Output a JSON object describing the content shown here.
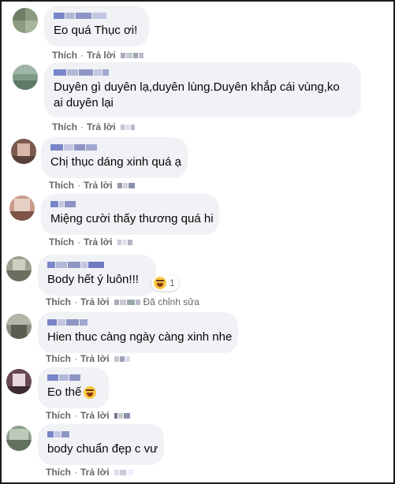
{
  "actions": {
    "like": "Thích",
    "reply": "Trả lời",
    "separator": "·"
  },
  "comments": [
    {
      "text": "Eo quá Thục ơi!"
    },
    {
      "text": "Duyên gì duyên lạ,duyên lùng.Duyên khắp cái vùng,ko ai duyên lại"
    },
    {
      "text": "Chị thục dáng xinh quá ạ"
    },
    {
      "text": "Miệng cười thấy thương quá hi"
    },
    {
      "text": "Body hết ý luôn!!!",
      "reaction": {
        "icon": "laughing-emoji",
        "count": "1"
      }
    },
    {
      "text": "Hien thuc càng ngày càng xinh nhe"
    },
    {
      "text": "Eo thế",
      "inline_emoji": "laughing-emoji"
    },
    {
      "text": "body chuẩn đẹp c vư"
    }
  ],
  "edited_label": "Đã chỉnh sửa",
  "colors": {
    "bubble": "#f0f2f5",
    "text": "#050505",
    "meta": "#65676b",
    "border": "#1a1a1a",
    "emoji": "#f7c744"
  }
}
